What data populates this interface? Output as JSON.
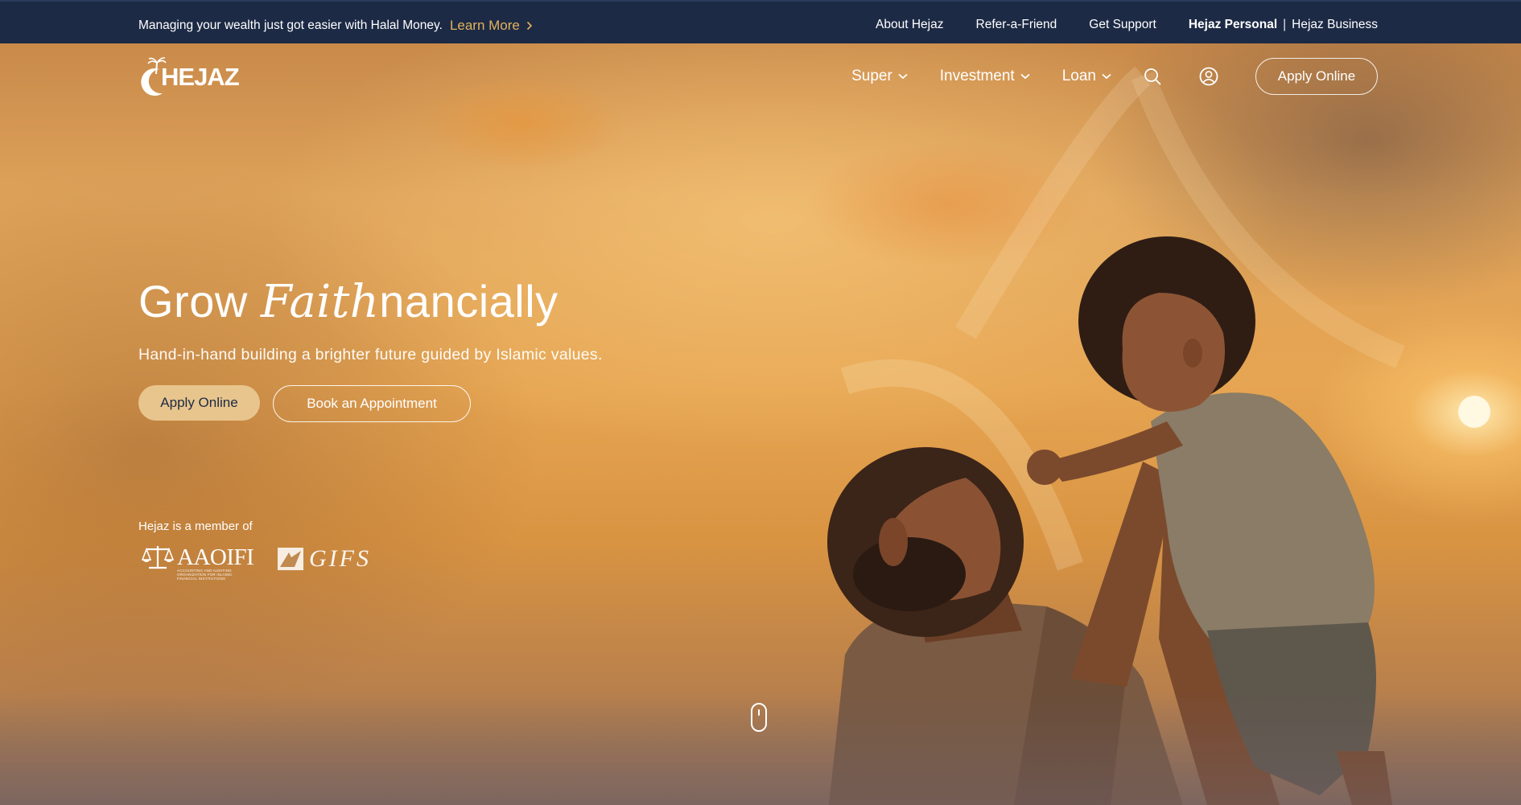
{
  "topbar": {
    "promo_text": "Managing your wealth just got easier with Halal Money.",
    "learn_more": "Learn More",
    "links": [
      "About Hejaz",
      "Refer-a-Friend",
      "Get Support"
    ],
    "personal": "Hejaz Personal",
    "separator": "|",
    "business": "Hejaz Business"
  },
  "header": {
    "logo_text": "HEJAZ",
    "nav": [
      {
        "label": "Super",
        "icon": "chevron-down-icon"
      },
      {
        "label": "Investment",
        "icon": "chevron-down-icon"
      },
      {
        "label": "Loan",
        "icon": "chevron-down-icon"
      }
    ],
    "search_icon": "search-icon",
    "account_icon": "user-circle-icon",
    "apply_label": "Apply Online"
  },
  "hero": {
    "headline_pre": "Grow ",
    "headline_italic": "Faith",
    "headline_post": "nancially",
    "subtitle": "Hand-in-hand building a brighter future guided by Islamic values.",
    "apply_label": "Apply Online",
    "appointment_label": "Book an Appointment",
    "member_text": "Hejaz is a member of",
    "partners": {
      "aaoifi": "AAOIFI",
      "aaoifi_tagline": "ACCOUNTING AND AUDITING ORGANIZATION FOR ISLAMIC FINANCIAL INSTITUTIONS",
      "gifs": "GIFS"
    },
    "scroll_icon": "mouse-scroll-icon"
  },
  "colors": {
    "navy": "#1c2a45",
    "gold": "#e3b25c",
    "button_fill": "#e8c58d"
  }
}
